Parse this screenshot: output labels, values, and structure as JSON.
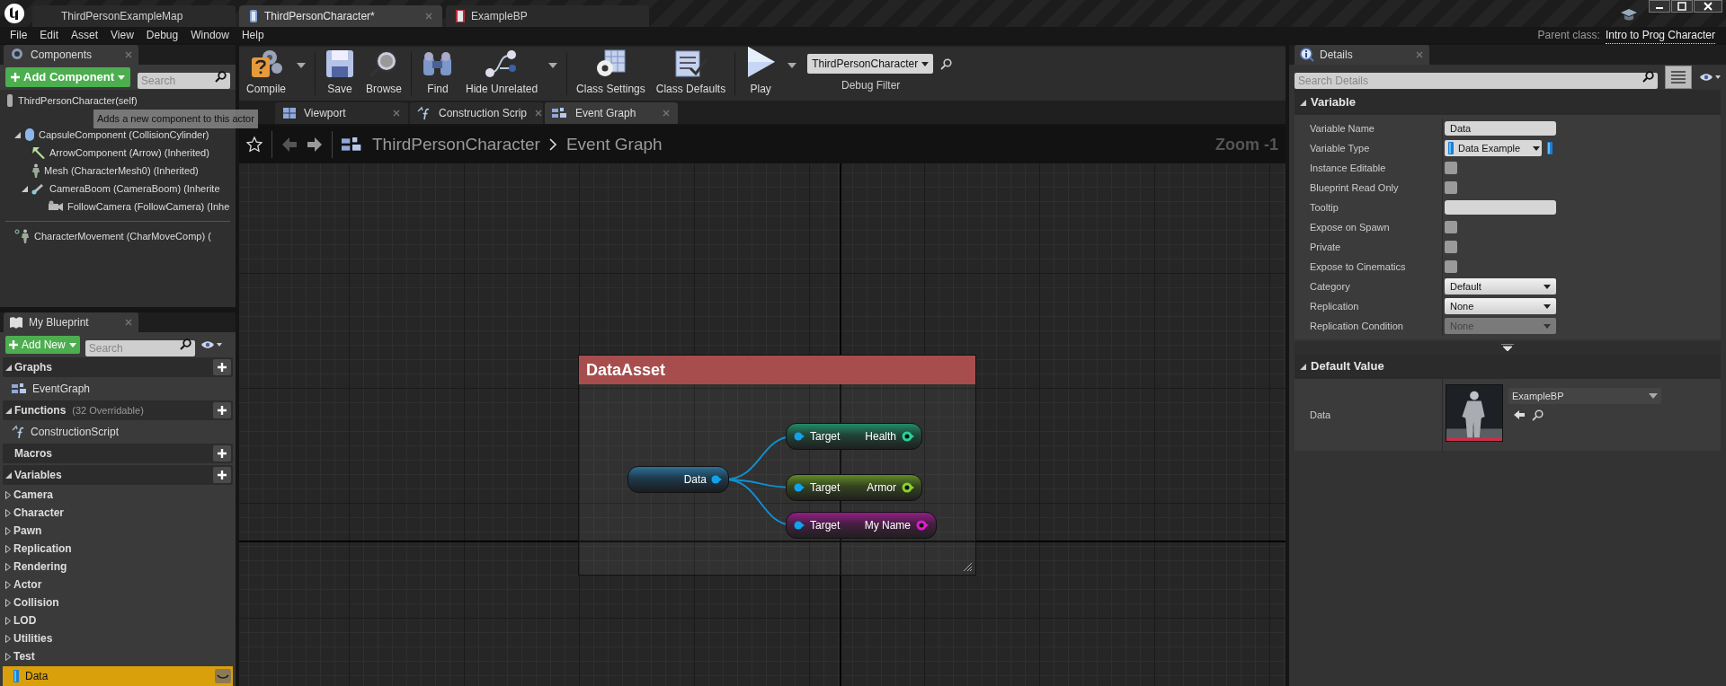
{
  "title_bar": {
    "tabs": [
      {
        "label": "ThirdPersonExampleMap",
        "kind": "map",
        "selected": false
      },
      {
        "label": "ThirdPersonCharacter*",
        "kind": "blueprint",
        "selected": true
      },
      {
        "label": "ExampleBP",
        "kind": "asset",
        "selected": false
      }
    ]
  },
  "menu_bar": {
    "items": [
      "File",
      "Edit",
      "Asset",
      "View",
      "Debug",
      "Window",
      "Help"
    ],
    "parent_class_label": "Parent class:",
    "parent_class": "Intro to Prog Character"
  },
  "components_panel": {
    "title": "Components",
    "add_button": "Add Component",
    "search_placeholder": "Search",
    "tooltip": "Adds a new component to this actor",
    "tree": [
      {
        "label": "ThirdPersonCharacter(self)",
        "kind": "self"
      },
      {
        "label": "CapsuleComponent (CollisionCylinder)",
        "kind": "capsule",
        "expanded": true,
        "children": [
          {
            "label": "ArrowComponent (Arrow) (Inherited)",
            "kind": "arrow"
          },
          {
            "label": "Mesh (CharacterMesh0) (Inherited)",
            "kind": "mesh"
          },
          {
            "label": "CameraBoom (CameraBoom) (Inherite",
            "kind": "boom",
            "expanded": true,
            "children": [
              {
                "label": "FollowCamera (FollowCamera) (Inhe",
                "kind": "camera"
              }
            ]
          }
        ]
      },
      {
        "label": "CharacterMovement (CharMoveComp) (",
        "kind": "movement"
      }
    ]
  },
  "my_blueprint": {
    "title": "My Blueprint",
    "add_button": "Add New",
    "search_placeholder": "Search",
    "sections": [
      {
        "title": "Graphs",
        "expanded": true,
        "items": [
          {
            "label": "EventGraph",
            "kind": "graph"
          }
        ]
      },
      {
        "title": "Functions",
        "note": "(32 Overridable)",
        "expanded": true,
        "items": [
          {
            "label": "ConstructionScript",
            "kind": "function"
          }
        ]
      },
      {
        "title": "Macros"
      },
      {
        "title": "Variables",
        "expanded": true,
        "categories": [
          {
            "label": "Camera",
            "expanded": false
          },
          {
            "label": "Character",
            "expanded": false
          },
          {
            "label": "Pawn",
            "expanded": false
          },
          {
            "label": "Replication",
            "expanded": false
          },
          {
            "label": "Rendering",
            "expanded": false
          },
          {
            "label": "Actor",
            "expanded": false
          },
          {
            "label": "Collision",
            "expanded": false
          },
          {
            "label": "LOD",
            "expanded": false
          },
          {
            "label": "Utilities",
            "expanded": false
          },
          {
            "label": "Test",
            "expanded": false
          }
        ],
        "items": [
          {
            "label": "Data",
            "kind": "variable",
            "selected": true
          }
        ]
      }
    ]
  },
  "toolbar": {
    "buttons": [
      {
        "label": "Compile",
        "kind": "compile",
        "dropdown": true
      },
      {
        "label": "Save",
        "kind": "save",
        "dropdown": false
      },
      {
        "label": "Browse",
        "kind": "browse",
        "dropdown": false
      },
      {
        "label": "Find",
        "kind": "find",
        "dropdown": false
      },
      {
        "label": "Hide Unrelated",
        "kind": "hide",
        "dropdown": true
      },
      {
        "label": "Class Settings",
        "kind": "settings",
        "dropdown": false
      },
      {
        "label": "Class Defaults",
        "kind": "defaults",
        "dropdown": false
      },
      {
        "label": "Play",
        "kind": "play",
        "dropdown": true
      }
    ],
    "debug_filter": {
      "value": "ThirdPersonCharacter",
      "label": "Debug Filter"
    }
  },
  "graph_tabs": [
    {
      "label": "Viewport",
      "kind": "viewport",
      "selected": false
    },
    {
      "label": "Construction Scrip",
      "kind": "function",
      "selected": false
    },
    {
      "label": "Event Graph",
      "kind": "graph",
      "selected": true
    }
  ],
  "breadcrumb": {
    "path": [
      "ThirdPersonCharacter",
      "Event Graph"
    ],
    "zoom": "Zoom -1"
  },
  "graph": {
    "comment": "DataAsset",
    "getter": "Data",
    "nodes": [
      {
        "input": "Target",
        "output": "Health",
        "color": "#25d39a"
      },
      {
        "input": "Target",
        "output": "Armor",
        "color": "#8bd22a"
      },
      {
        "input": "Target",
        "output": "My Name",
        "color": "#e01ccb"
      }
    ]
  },
  "details": {
    "title": "Details",
    "search_placeholder": "Search Details",
    "section": "Variable",
    "rows": [
      {
        "label": "Variable Name",
        "kind": "text",
        "value": "Data"
      },
      {
        "label": "Variable Type",
        "kind": "type",
        "value": "Data Example"
      },
      {
        "label": "Instance Editable",
        "kind": "checkbox",
        "checked": false
      },
      {
        "label": "Blueprint Read Only",
        "kind": "checkbox",
        "checked": false
      },
      {
        "label": "Tooltip",
        "kind": "text"
      },
      {
        "label": "Expose on Spawn",
        "kind": "checkbox",
        "checked": false
      },
      {
        "label": "Private",
        "kind": "checkbox",
        "checked": false
      },
      {
        "label": "Expose to Cinematics",
        "kind": "checkbox",
        "checked": false
      },
      {
        "label": "Category",
        "kind": "combo",
        "value": "Default"
      },
      {
        "label": "Replication",
        "kind": "dropdown",
        "value": "None"
      },
      {
        "label": "Replication Condition",
        "kind": "dropdown",
        "value": "None",
        "disabled": true
      }
    ],
    "default_section": "Default Value",
    "default_row": {
      "label": "Data",
      "value": "ExampleBP"
    }
  }
}
